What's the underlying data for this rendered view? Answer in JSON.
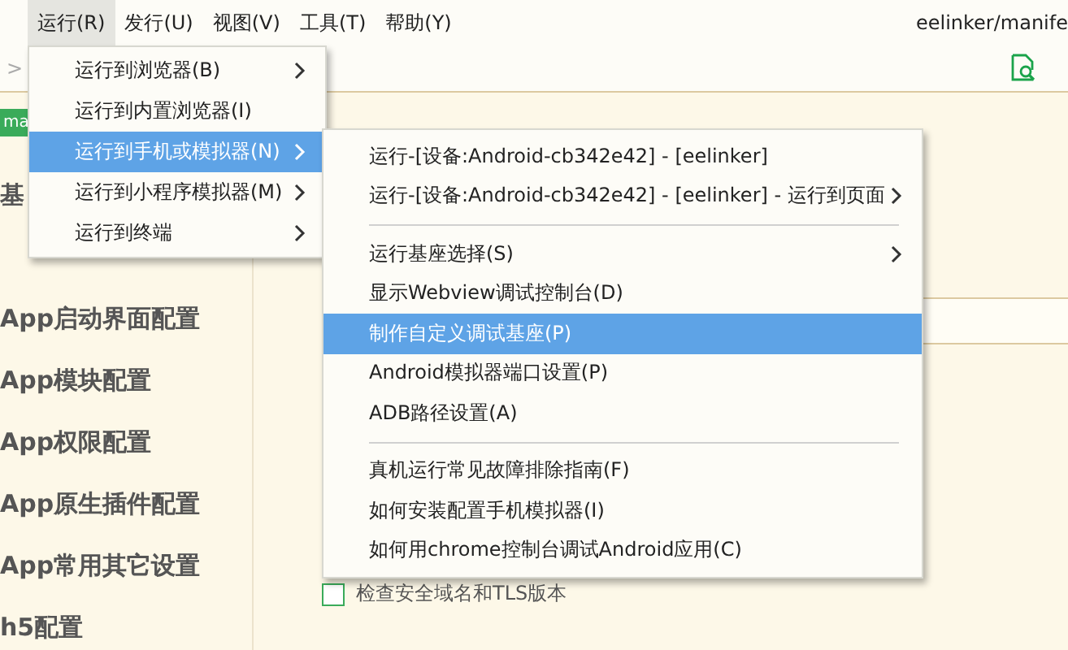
{
  "menubar": [
    {
      "label": "运行(R)",
      "selected": true
    },
    {
      "label": "发行(U)",
      "selected": false
    },
    {
      "label": "视图(V)",
      "selected": false
    },
    {
      "label": "工具(T)",
      "selected": false
    },
    {
      "label": "帮助(Y)",
      "selected": false
    }
  ],
  "file_path": "eelinker/manife",
  "toolbar": {
    "chevron": ">"
  },
  "tab_tag": "ma",
  "sidebar": {
    "items": [
      "基",
      "App启动界面配置",
      "App模块配置",
      "App权限配置",
      "App原生插件配置",
      "App常用其它设置",
      "h5配置"
    ]
  },
  "content": {
    "checkbox": {
      "label": "检查安全域名和TLS版本",
      "checked": false
    }
  },
  "menu": {
    "items": [
      {
        "label": "运行到浏览器(B)",
        "submenu": true,
        "selected": false
      },
      {
        "label": "运行到内置浏览器(I)",
        "submenu": false,
        "selected": false
      },
      {
        "label": "运行到手机或模拟器(N)",
        "submenu": true,
        "selected": true
      },
      {
        "label": "运行到小程序模拟器(M)",
        "submenu": true,
        "selected": false
      },
      {
        "label": "运行到终端",
        "submenu": true,
        "selected": false
      }
    ]
  },
  "submenu": {
    "groups": [
      [
        {
          "label": "运行-[设备:Android-cb342e42] - [eelinker]",
          "submenu": false,
          "selected": false
        },
        {
          "label": "运行-[设备:Android-cb342e42] - [eelinker] - 运行到页面",
          "submenu": true,
          "selected": false
        }
      ],
      [
        {
          "label": "运行基座选择(S)",
          "submenu": true,
          "selected": false
        },
        {
          "label": "显示Webview调试控制台(D)",
          "submenu": false,
          "selected": false
        },
        {
          "label": "制作自定义调试基座(P)",
          "submenu": false,
          "selected": true
        },
        {
          "label": "Android模拟器端口设置(P)",
          "submenu": false,
          "selected": false
        },
        {
          "label": "ADB路径设置(A)",
          "submenu": false,
          "selected": false
        }
      ],
      [
        {
          "label": "真机运行常见故障排除指南(F)",
          "submenu": false,
          "selected": false
        },
        {
          "label": "如何安装配置手机模拟器(I)",
          "submenu": false,
          "selected": false
        },
        {
          "label": "如何用chrome控制台调试Android应用(C)",
          "submenu": false,
          "selected": false
        }
      ]
    ]
  }
}
